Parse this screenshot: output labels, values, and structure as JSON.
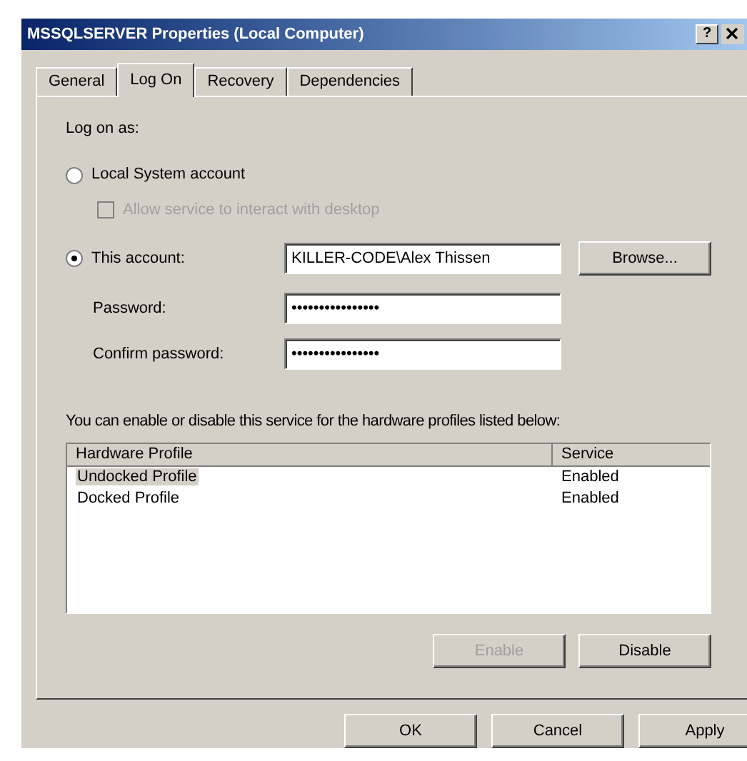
{
  "window": {
    "title": "MSSQLSERVER Properties (Local Computer)",
    "help": "?"
  },
  "tabs": [
    {
      "label": "General",
      "selected": false
    },
    {
      "label": "Log On",
      "selected": true
    },
    {
      "label": "Recovery",
      "selected": false
    },
    {
      "label": "Dependencies",
      "selected": false
    }
  ],
  "log_on_as": {
    "label": "Log on as:",
    "local_system": {
      "label": "Local System account",
      "selected": false
    },
    "interact_desktop": {
      "label": "Allow service to interact with desktop",
      "checked": false,
      "disabled": true
    },
    "this_account": {
      "label": "This account:",
      "selected": true,
      "value": "KILLER-CODE\\Alex Thissen",
      "browse": "Browse..."
    },
    "password": {
      "label": "Password:",
      "value": "••••••••••••••••"
    },
    "confirm_password": {
      "label": "Confirm password:",
      "value": "••••••••••••••••"
    }
  },
  "profiles": {
    "description": "You can enable or disable this service for the hardware profiles listed below:",
    "columns": [
      "Hardware Profile",
      "Service"
    ],
    "rows": [
      {
        "profile": "Undocked Profile",
        "service": "Enabled",
        "selected": true
      },
      {
        "profile": "Docked Profile",
        "service": "Enabled",
        "selected": false
      }
    ],
    "buttons": [
      {
        "label": "Enable",
        "disabled": true
      },
      {
        "label": "Disable",
        "disabled": false
      }
    ]
  },
  "buttons": [
    "OK",
    "Cancel",
    "Apply"
  ]
}
